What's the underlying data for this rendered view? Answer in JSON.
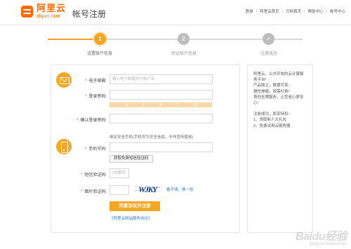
{
  "header": {
    "logo_cn": "阿里云",
    "logo_en": "aliyun.com",
    "page_title": "帐号注册",
    "nav": [
      "登录",
      "阿里云首页",
      "万网首页",
      "帮助中心",
      "帐号中心"
    ]
  },
  "steps": [
    {
      "number": "1",
      "label": "设置账户信息",
      "active": true
    },
    {
      "number": "2",
      "label": "验证账户信息",
      "active": false
    },
    {
      "number": "✓",
      "label": "注册成功",
      "active": false
    }
  ],
  "form": {
    "email_label": "电子邮箱:",
    "email_placeholder": "输入电子邮箱作为帐户名",
    "password_label": "登录密码:",
    "password_value": "",
    "strength_levels": [
      "弱",
      "中",
      "强"
    ],
    "confirm_label": "确认登录密码:",
    "confirm_value": "",
    "phone_hint": "绑定安全手机(手机号为安全信息，不作宣传使用)",
    "phone_label": "手机号码:",
    "phone_value": "",
    "sms_button": "获取免费短信验证码",
    "sms_label": "短信验证码:",
    "sms_placeholder": "6位数字",
    "captcha_label": "图片验证码:",
    "captcha_value": "",
    "captcha_text": "WJKY",
    "captcha_refresh": "看不清，换一张",
    "submit": "同意协议并注册",
    "agreement": "《阿里云网站服务协议》"
  },
  "sidebar": {
    "intro": [
      "阿里云，公共开放的云计算服",
      "务平台!",
      "产品独立，数据可靠;",
      "弹性伸缩，按需付费!",
      "首创全牌服务，让您省心更安",
      "心!"
    ],
    "after_title": "注册成功，即享特权:",
    "benefits": [
      "1、领取新人大礼包",
      "2、免费试用云服务器"
    ]
  },
  "watermark": {
    "text": "Baidu经验",
    "sub": "jingyan.baidu.com"
  },
  "colors": {
    "accent": "#ff6a00",
    "primary_button": "#f5a623",
    "link": "#2a7bd4"
  }
}
